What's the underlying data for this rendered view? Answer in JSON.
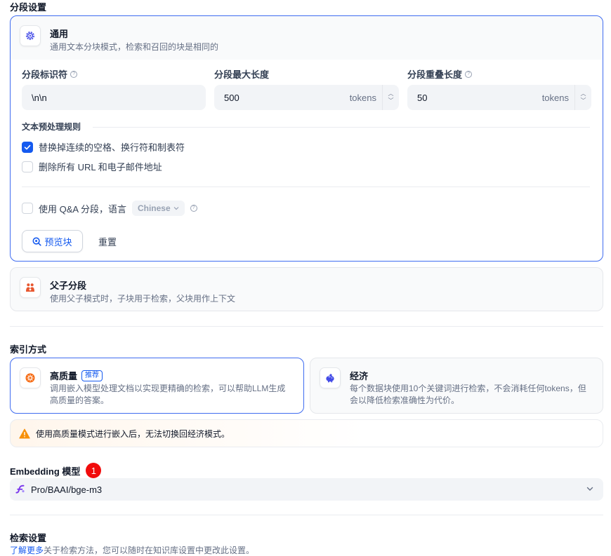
{
  "segment": {
    "section_title": "分段设置",
    "general": {
      "title": "通用",
      "desc": "通用文本分块模式，检索和召回的块是相同的",
      "fields": {
        "separator_label": "分段标识符",
        "separator_value": "\\n\\n",
        "max_len_label": "分段最大长度",
        "max_len_value": "500",
        "max_len_unit": "tokens",
        "overlap_label": "分段重叠长度",
        "overlap_value": "50",
        "overlap_unit": "tokens"
      },
      "preprocess_title": "文本预处理规则",
      "rule_spaces": "替换掉连续的空格、换行符和制表符",
      "rule_spaces_checked": true,
      "rule_urls": "删除所有 URL 和电子邮件地址",
      "rule_urls_checked": false,
      "qa_label": "使用 Q&A 分段，语言",
      "qa_language": "Chinese",
      "preview_btn": "预览块",
      "reset_btn": "重置"
    },
    "parent_child": {
      "title": "父子分段",
      "desc": "使用父子模式时，子块用于检索，父块用作上下文"
    }
  },
  "index": {
    "section_title": "索引方式",
    "high_quality": {
      "title": "高质量",
      "badge": "推荐",
      "desc": "调用嵌入模型处理文档以实现更精确的检索，可以帮助LLM生成高质量的答案。"
    },
    "economy": {
      "title": "经济",
      "desc": "每个数据块使用10个关键词进行检索，不会消耗任何tokens，但会以降低检索准确性为代价。"
    },
    "warning": "使用高质量模式进行嵌入后，无法切换回经济模式。"
  },
  "embedding": {
    "title": "Embedding 模型",
    "badge_number": "1",
    "model": "Pro/BAAI/bge-m3"
  },
  "retrieval": {
    "title": "检索设置",
    "learn_more": "了解更多",
    "desc": "关于检索方法，您可以随时在知识库设置中更改此设置。"
  },
  "colors": {
    "accent": "#155aef",
    "active_border": "#3f6cf0",
    "warning": "#f79009",
    "badge_red": "#f10c0c"
  }
}
